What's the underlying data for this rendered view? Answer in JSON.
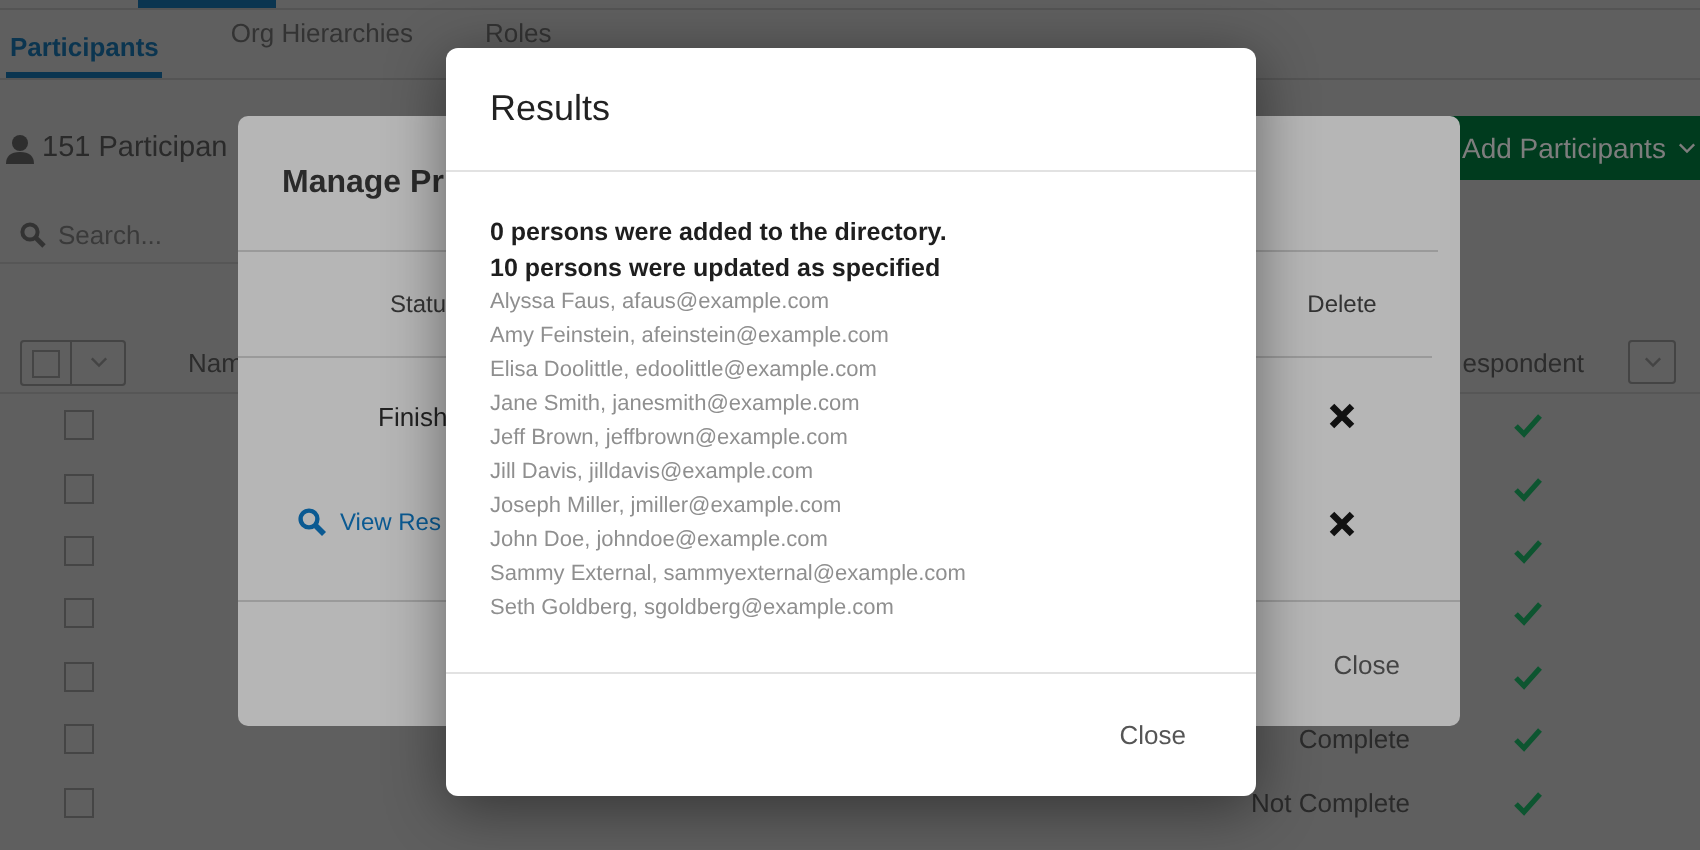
{
  "tabs": [
    {
      "label": "Participants",
      "selected": true
    },
    {
      "label": "Org Hierarchies",
      "selected": false
    },
    {
      "label": "Roles",
      "selected": false
    }
  ],
  "participant_count": "151 Participan",
  "add_button": {
    "label": "Add Participants"
  },
  "search": {
    "placeholder": "Search..."
  },
  "table": {
    "columns": [
      "Nam",
      "espondent"
    ],
    "rows": [
      {
        "checked": false,
        "responded": true
      },
      {
        "checked": false,
        "responded": true
      },
      {
        "checked": false,
        "responded": true
      },
      {
        "checked": false,
        "responded": true
      },
      {
        "checked": false,
        "responded": true
      },
      {
        "checked": false,
        "responded": true,
        "status": "Complete"
      },
      {
        "checked": false,
        "responded": true,
        "status": "Not Complete"
      }
    ]
  },
  "manage_dialog": {
    "title": "Manage Pr",
    "columns": [
      "Statu",
      "Delete"
    ],
    "rows": [
      {
        "kind": "text",
        "status": "Finish"
      },
      {
        "kind": "link",
        "status": "View Res"
      }
    ],
    "close": "Close"
  },
  "results_dialog": {
    "title": "Results",
    "summary": [
      "0 persons were added to the directory.",
      "10 persons were updated as specified"
    ],
    "entries": [
      "Alyssa Faus, afaus@example.com",
      "Amy Feinstein, afeinstein@example.com",
      "Elisa Doolittle, edoolittle@example.com",
      "Jane Smith, janesmith@example.com",
      "Jeff Brown, jeffbrown@example.com",
      "Jill Davis, jilldavis@example.com",
      "Joseph Miller, jmiller@example.com",
      "John Doe, johndoe@example.com",
      "Sammy External, sammyexternal@example.com",
      "Seth Goldberg, sgoldberg@example.com"
    ],
    "close": "Close"
  }
}
